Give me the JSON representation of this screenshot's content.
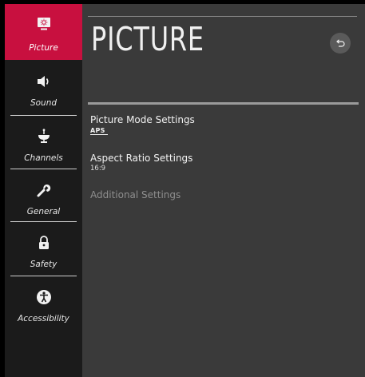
{
  "sidebar": {
    "items": [
      {
        "label": "Picture",
        "icon": "picture-settings-icon",
        "active": true
      },
      {
        "label": "Sound",
        "icon": "speaker-icon",
        "active": false
      },
      {
        "label": "Channels",
        "icon": "antenna-dish-icon",
        "active": false
      },
      {
        "label": "General",
        "icon": "wrench-icon",
        "active": false
      },
      {
        "label": "Safety",
        "icon": "lock-icon",
        "active": false
      },
      {
        "label": "Accessibility",
        "icon": "accessibility-icon",
        "active": false
      }
    ]
  },
  "panel": {
    "title": "PICTURE",
    "back_icon": "back-arrow-icon",
    "menu": [
      {
        "label": "Picture Mode Settings",
        "badge": "APS"
      },
      {
        "label": "Aspect Ratio Settings",
        "value": "16:9"
      },
      {
        "label": "Additional Settings"
      }
    ]
  },
  "colors": {
    "accent": "#c8103f",
    "sidebar_bg": "#1b1b1b",
    "panel_bg": "#3a3a3a"
  }
}
